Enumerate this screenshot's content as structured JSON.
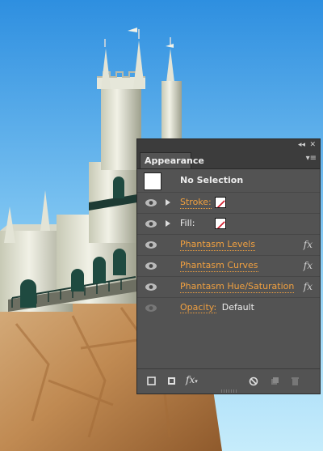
{
  "panel": {
    "collapse_icon": "double-chevron-icon",
    "close_icon": "close-icon",
    "tab_label": "Appearance",
    "menu_icon": "panel-menu-icon",
    "selection_label": "No Selection",
    "rows": [
      {
        "kind": "stroke",
        "label": "Stroke:"
      },
      {
        "kind": "fill",
        "label": "Fill:"
      },
      {
        "kind": "effect",
        "label": "Phantasm Levels"
      },
      {
        "kind": "effect",
        "label": "Phantasm Curves"
      },
      {
        "kind": "effect",
        "label": "Phantasm Hue/Saturation"
      },
      {
        "kind": "opacity",
        "label": "Opacity:",
        "value": "Default"
      }
    ],
    "fx_label": "fx",
    "bottom_fx_label": "fx"
  },
  "colors": {
    "panel_bg": "#535353",
    "link_orange": "#f0a040",
    "sky": "#3a9ee6"
  }
}
